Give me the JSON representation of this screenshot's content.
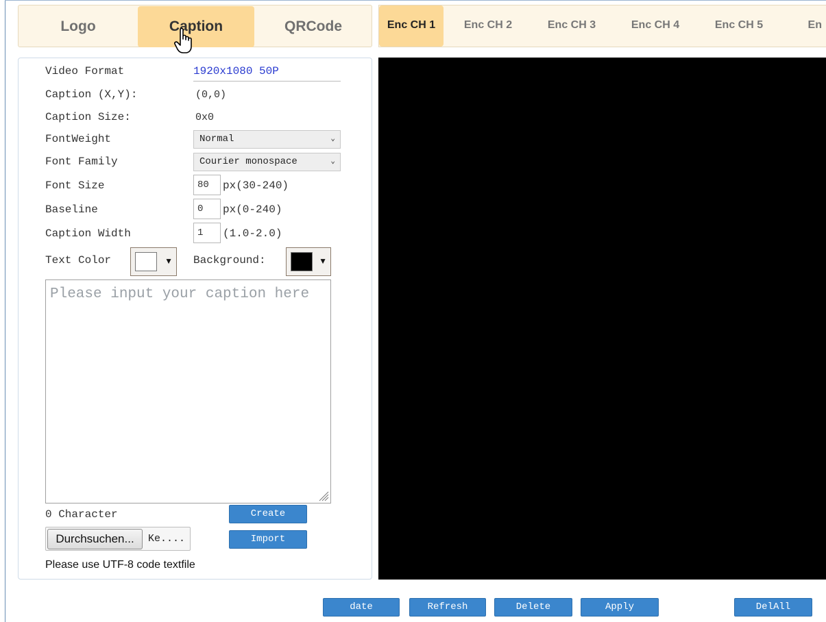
{
  "tabs": [
    "Logo",
    "Caption",
    "QRCode"
  ],
  "enc_tabs": [
    "Enc CH 1",
    "Enc CH 2",
    "Enc CH 3",
    "Enc CH 4",
    "Enc CH 5",
    "En"
  ],
  "settings": {
    "video_format_label": "Video Format",
    "video_format_value": "1920x1080 50P",
    "position_label": "Caption (X,Y):",
    "position_value": "(0,0)",
    "size_label": "Caption Size:",
    "size_value": "0x0",
    "fontweight_label": "FontWeight",
    "fontweight_value": "Normal",
    "fontfamily_label": "Font Family",
    "fontfamily_value": "Courier monospace",
    "fontsize_label": "Font Size",
    "fontsize_value": "80",
    "fontsize_hint": "px(30-240)",
    "baseline_label": "Baseline",
    "baseline_value": "0",
    "baseline_hint": "px(0-240)",
    "width_label": "Caption Width",
    "width_value": "1",
    "width_hint": "(1.0-2.0)",
    "textcolor_label": "Text Color",
    "background_label": "Background:"
  },
  "colors": {
    "text_color": "#ffffff",
    "background_color": "#000000",
    "accent": "#3b86cd",
    "active_tab": "#fcd997"
  },
  "caption_placeholder": "Please input your caption here",
  "char_count": "0 Character",
  "buttons": {
    "create": "Create",
    "import": "Import",
    "browse": "Durchsuchen...",
    "file_name": "Ke....",
    "date": "date",
    "refresh": "Refresh",
    "delete": "Delete",
    "apply": "Apply",
    "delall": "DelAll"
  },
  "note": "Please use UTF-8 code textfile",
  "icons": {
    "cursor": "hand-pointer-icon",
    "dropdown": "chevron-down-icon",
    "swatch_arrow": "triangle-down-icon",
    "resize": "resize-grip-icon"
  }
}
